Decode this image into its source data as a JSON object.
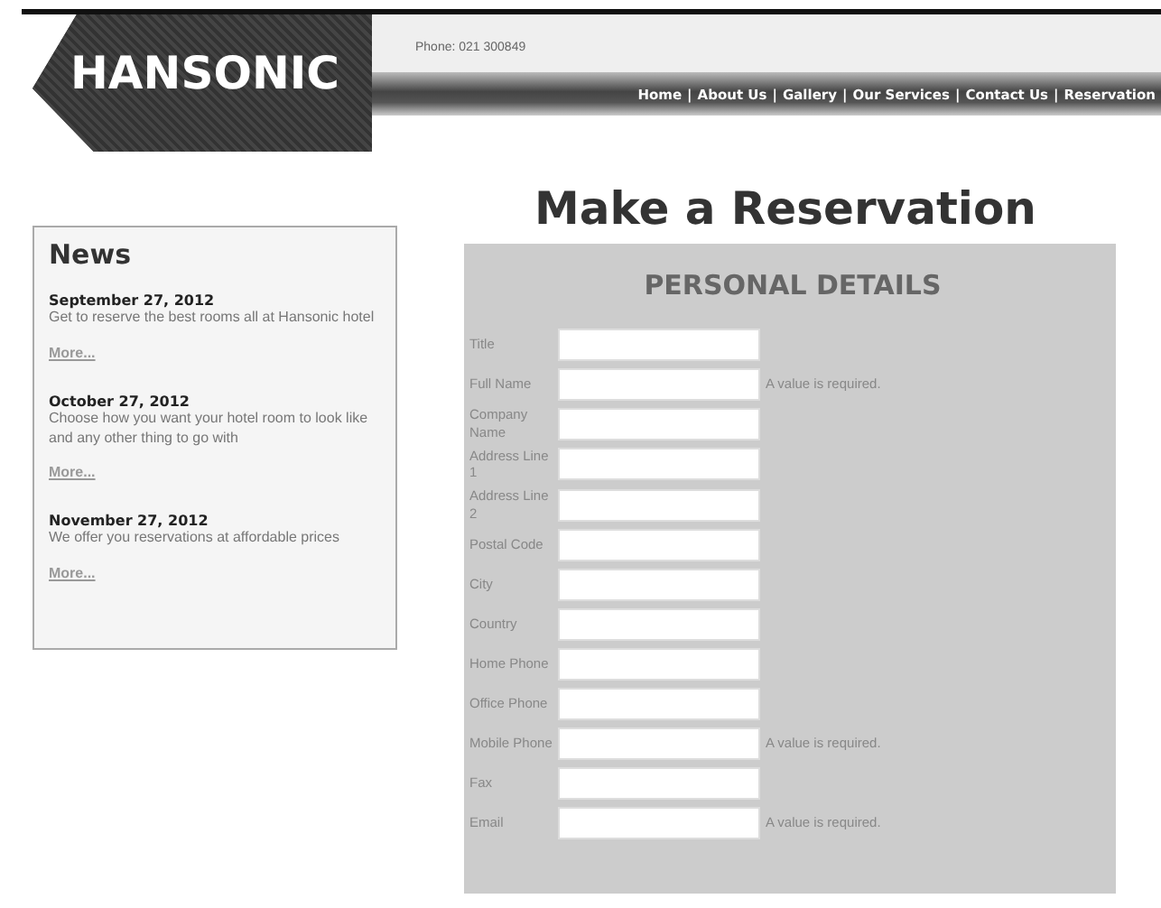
{
  "header": {
    "logo": "HANSONIC",
    "phone": "Phone: 021 300849"
  },
  "nav": [
    {
      "label": "Home"
    },
    {
      "separator": "|",
      "label": "About Us"
    },
    {
      "separator": "|",
      "label": "Gallery"
    },
    {
      "separator": "|",
      "label": "Our Services"
    },
    {
      "separator": "|",
      "label": "Contact Us"
    },
    {
      "separator": "|",
      "label": "Reservation"
    }
  ],
  "page_title": "Make a Reservation",
  "news": {
    "title": "News",
    "items": [
      {
        "date": "September 27, 2012",
        "text": "Get to reserve the best rooms all at Hansonic hotel",
        "link": "More..."
      },
      {
        "date": "October 27, 2012",
        "text": "Choose how you want your hotel room to look like and any other thing to go with",
        "link": "More..."
      },
      {
        "date": "November 27, 2012",
        "text": "We offer you reservations at affordable prices",
        "link": "More..."
      }
    ]
  },
  "form": {
    "title": "PERSONAL DETAILS",
    "fields": [
      {
        "label": "Title"
      },
      {
        "label": "Full Name",
        "error": "A value is required."
      },
      {
        "label": "Company Name"
      },
      {
        "label": "Address Line 1"
      },
      {
        "label": "Address Line 2"
      },
      {
        "label": "Postal Code"
      },
      {
        "label": "City"
      },
      {
        "label": "Country"
      },
      {
        "label": "Home Phone"
      },
      {
        "label": "Office Phone"
      },
      {
        "label": "Mobile Phone",
        "error": "A value is required."
      },
      {
        "label": "Fax"
      },
      {
        "label": "Email",
        "error": "A value is required."
      }
    ]
  }
}
